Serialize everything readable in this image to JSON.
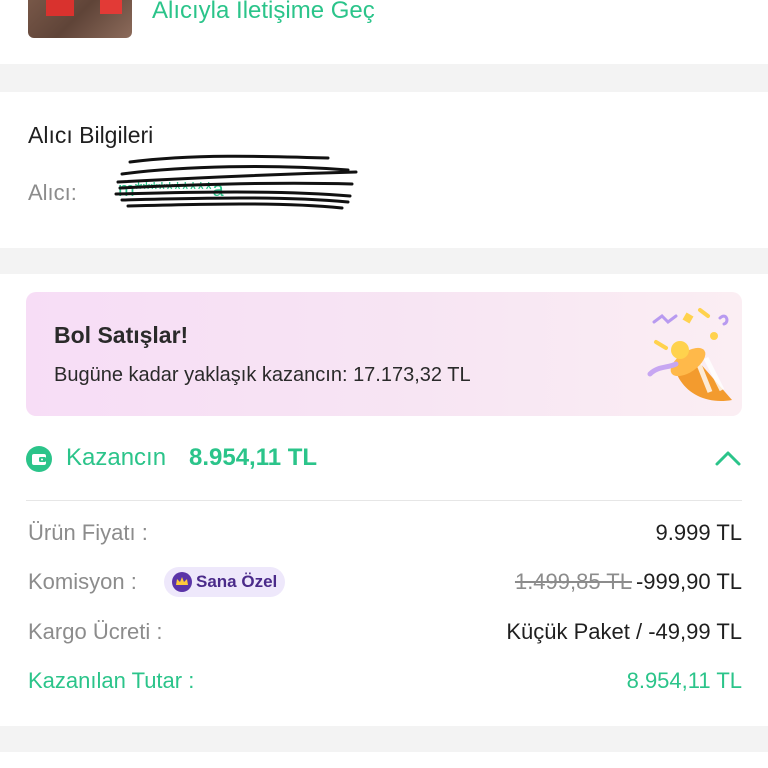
{
  "top": {
    "contact_link": "Alıcıyla İletişime Geç"
  },
  "buyer": {
    "title": "Alıcı Bilgileri",
    "label": "Alıcı:",
    "name": "m**********a"
  },
  "promo": {
    "title": "Bol Satışlar!",
    "subtitle": "Bugüne kadar yaklaşık kazancın: 17.173,32 TL"
  },
  "earnings": {
    "label": "Kazancın",
    "value": "8.954,11 TL",
    "expanded": true
  },
  "breakdown": {
    "price_label": "Ürün Fiyatı :",
    "price_value": "9.999 TL",
    "commission_label": "Komisyon :",
    "commission_badge": "Sana Özel",
    "commission_old": "1.499,85 TL",
    "commission_value": "-999,90 TL",
    "shipping_label": "Kargo Ücreti :",
    "shipping_value": "Küçük Paket / -49,99 TL",
    "total_label": "Kazanılan Tutar :",
    "total_value": "8.954,11 TL"
  },
  "colors": {
    "accent_green": "#2bc48a",
    "promo_bg": "#f7ddf6",
    "badge_purple": "#4b2b8a"
  },
  "icons": [
    "wallet-icon",
    "chevron-up-icon",
    "party-popper-icon",
    "crown-icon"
  ]
}
